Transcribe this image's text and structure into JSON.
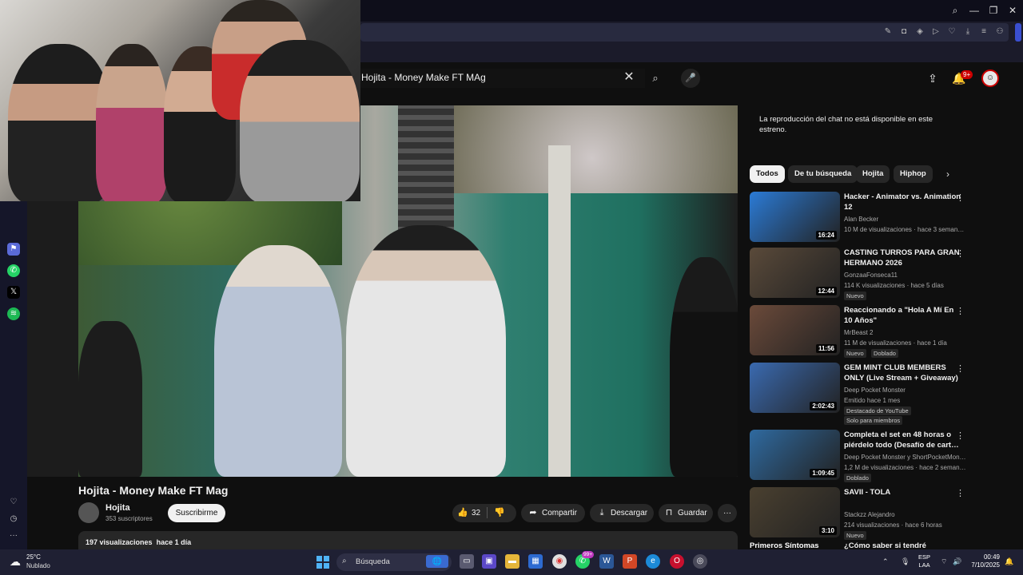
{
  "browser": {
    "window_controls": {
      "search": "⌕",
      "minimize": "—",
      "maximize": "❐",
      "close": "✕"
    }
  },
  "youtube": {
    "search": {
      "query": "Hojita - Money Make FT MAg",
      "clear": "✕",
      "search_icon": "⌕",
      "mic_icon": "🎤"
    },
    "notifications_badge": "9+",
    "video": {
      "title": "Hojita - Money Make FT Mag",
      "channel": "Hojita",
      "subscribers": "353 suscriptores",
      "subscribe_label": "Suscribirme",
      "likes": "32",
      "share_label": "Compartir",
      "download_label": "Descargar",
      "save_label": "Guardar",
      "more": "···",
      "views": "197 visualizaciones",
      "uploaded": "hace 1 día"
    },
    "chat_message": "La reproducción del chat no está disponible en este estreno.",
    "chips": [
      "Todos",
      "De tu búsqueda",
      "Hojita",
      "Hiphop"
    ],
    "recommendations": [
      {
        "title": "Hacker - Animator vs. Animation 12",
        "channel": "Alan Becker",
        "meta": "10 M de visualizaciones · hace 3 seman…",
        "duration": "16:24",
        "badges": [],
        "thumb_color": "#2b7bd6"
      },
      {
        "title": "CASTING TURROS PARA GRAN HERMANO 2026",
        "channel": "GonzaaFonseca11",
        "meta": "114 K visualizaciones · hace 5 días",
        "duration": "12:44",
        "badges": [
          "Nuevo"
        ],
        "thumb_color": "#5a4a3a"
      },
      {
        "title": "Reaccionando a \"Hola A Mí En 10 Años\"",
        "channel": "MrBeast 2",
        "meta": "11 M de visualizaciones · hace 1 día",
        "duration": "11:56",
        "badges": [
          "Nuevo",
          "Doblado"
        ],
        "thumb_color": "#6b4a3a"
      },
      {
        "title": "GEM MINT CLUB MEMBERS ONLY (Live Stream + Giveaway)",
        "channel": "Deep Pocket Monster",
        "meta": "Emitido hace 1 mes",
        "duration": "2:02:43",
        "badges": [
          "Destacado de YouTube",
          "Solo para miembros"
        ],
        "thumb_color": "#3a6ab0"
      },
      {
        "title": "Completa el set en 48 horas o piérdelo todo (Desafío de cart…",
        "channel": "Deep Pocket Monster y ShortPocketMon…",
        "meta": "1,2 M de visualizaciones · hace 2 seman…",
        "duration": "1:09:45",
        "badges": [
          "Doblado"
        ],
        "thumb_color": "#2f6aa0"
      },
      {
        "title": "SAVII - TOLA",
        "channel": "Stackzz Alejandro",
        "meta": "214 visualizaciones · hace 6 horas",
        "duration": "3:10",
        "badges": [
          "Nuevo"
        ],
        "thumb_color": "#4a4030"
      }
    ],
    "partial_next": {
      "left": "Primeros Síntomas",
      "right": "¿Cómo saber si tendré"
    }
  },
  "taskbar": {
    "temperature": "25°C",
    "condition": "Nublado",
    "search_label": "Búsqueda",
    "chat_badge": "99+",
    "lang_top": "ESP",
    "lang_bottom": "LAA",
    "time": "00:49",
    "date": "7/10/2025"
  },
  "colors": {
    "accent_red": "#cc0000",
    "taskbar": "#1f2033",
    "youtube_bg": "#0f0f0f"
  }
}
